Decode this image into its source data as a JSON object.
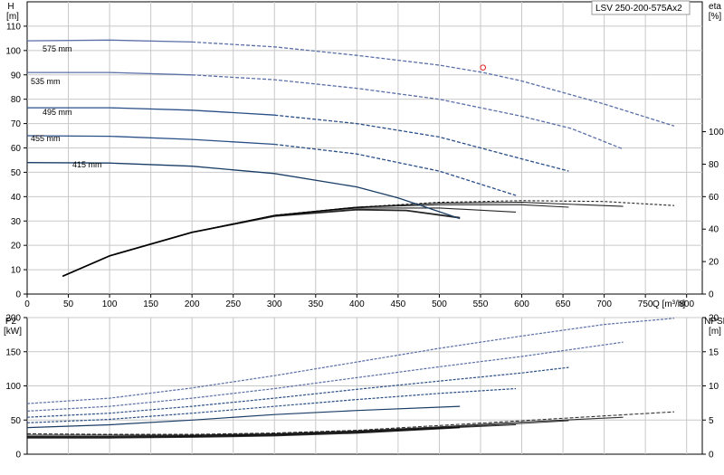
{
  "chart_data": [
    {
      "type": "line",
      "model_label": "LSV 250-200-575Ax2",
      "xlabel": "Q [m³/h]",
      "ylabel_left": [
        "H",
        "[m]"
      ],
      "ylabel_right": [
        "eta",
        "[%]"
      ],
      "xlim": [
        0,
        800
      ],
      "xticks": [
        0,
        50,
        100,
        150,
        200,
        250,
        300,
        350,
        400,
        450,
        500,
        550,
        600,
        650,
        700,
        750,
        800
      ],
      "ylim": [
        0,
        120
      ],
      "yticks": [
        0,
        10,
        20,
        30,
        40,
        50,
        60,
        70,
        80,
        90,
        100,
        110
      ],
      "y2lim": [
        0,
        180
      ],
      "y2ticks": [
        0,
        20,
        40,
        60,
        80,
        100
      ],
      "grid": true,
      "marker": {
        "x": 553,
        "y": 93
      },
      "head_series": [
        {
          "name": "575 mm",
          "points": [
            [
              0,
              104
            ],
            [
              100,
              104.3
            ],
            [
              200,
              103.5
            ],
            [
              300,
              101.5
            ],
            [
              400,
              98
            ],
            [
              500,
              94
            ],
            [
              553,
              91
            ],
            [
              600,
              87.5
            ],
            [
              700,
              78
            ],
            [
              785,
              69
            ]
          ]
        },
        {
          "name": "535 mm",
          "points": [
            [
              0,
              91
            ],
            [
              100,
              91
            ],
            [
              200,
              90
            ],
            [
              300,
              88
            ],
            [
              400,
              84.5
            ],
            [
              500,
              80
            ],
            [
              600,
              73
            ],
            [
              660,
              68
            ],
            [
              723,
              59.5
            ]
          ]
        },
        {
          "name": "495 mm",
          "points": [
            [
              0,
              76.5
            ],
            [
              100,
              76.5
            ],
            [
              200,
              75.5
            ],
            [
              300,
              73.5
            ],
            [
              400,
              70
            ],
            [
              500,
              64.5
            ],
            [
              600,
              55.5
            ],
            [
              657,
              50.5
            ]
          ]
        },
        {
          "name": "455 mm",
          "points": [
            [
              0,
              65
            ],
            [
              100,
              64.8
            ],
            [
              200,
              63.5
            ],
            [
              300,
              61.5
            ],
            [
              400,
              57.5
            ],
            [
              500,
              50.5
            ],
            [
              593,
              40.5
            ]
          ]
        },
        {
          "name": "415 mm",
          "points": [
            [
              0,
              54
            ],
            [
              100,
              53.8
            ],
            [
              200,
              52.5
            ],
            [
              300,
              49.5
            ],
            [
              400,
              44
            ],
            [
              450,
              39.5
            ],
            [
              525,
              31
            ]
          ]
        }
      ],
      "eta_series": [
        {
          "points": [
            [
              43,
              11
            ],
            [
              100,
              23.5
            ],
            [
              200,
              38
            ],
            [
              300,
              48.5
            ],
            [
              400,
              53.5
            ],
            [
              500,
              56.5
            ],
            [
              600,
              57.5
            ],
            [
              700,
              57
            ],
            [
              785,
              54.5
            ]
          ]
        },
        {
          "points": [
            [
              43,
              11
            ],
            [
              100,
              23.5
            ],
            [
              200,
              38
            ],
            [
              300,
              48.5
            ],
            [
              400,
              53.5
            ],
            [
              500,
              56
            ],
            [
              600,
              56.5
            ],
            [
              723,
              54
            ]
          ]
        },
        {
          "points": [
            [
              43,
              11
            ],
            [
              100,
              23.5
            ],
            [
              200,
              38
            ],
            [
              300,
              48.5
            ],
            [
              400,
              53.5
            ],
            [
              500,
              55
            ],
            [
              600,
              55
            ],
            [
              657,
              53.5
            ]
          ]
        },
        {
          "points": [
            [
              43,
              11
            ],
            [
              100,
              23.5
            ],
            [
              200,
              38
            ],
            [
              300,
              48.5
            ],
            [
              400,
              53
            ],
            [
              500,
              53
            ],
            [
              593,
              50.5
            ]
          ]
        },
        {
          "points": [
            [
              43,
              11
            ],
            [
              100,
              23.5
            ],
            [
              200,
              38
            ],
            [
              300,
              48
            ],
            [
              400,
              52
            ],
            [
              460,
              51.5
            ],
            [
              525,
              47
            ]
          ]
        }
      ]
    },
    {
      "type": "line",
      "xlim": [
        0,
        800
      ],
      "ylabel_left": [
        "P2",
        "[kW]"
      ],
      "ylabel_right": [
        "NPSH",
        "[m]"
      ],
      "ylim": [
        0,
        200
      ],
      "yticks": [
        0,
        50,
        100,
        150,
        200
      ],
      "y2lim": [
        0,
        20
      ],
      "y2ticks": [
        0,
        5,
        10,
        15,
        20
      ],
      "grid": true,
      "power_series": [
        {
          "points": [
            [
              0,
              74
            ],
            [
              100,
              82
            ],
            [
              200,
              97
            ],
            [
              300,
              115
            ],
            [
              400,
              135
            ],
            [
              500,
              155
            ],
            [
              600,
              173
            ],
            [
              700,
              190
            ],
            [
              785,
              199
            ]
          ]
        },
        {
          "points": [
            [
              0,
              63
            ],
            [
              100,
              70
            ],
            [
              200,
              82
            ],
            [
              300,
              96
            ],
            [
              400,
              112
            ],
            [
              500,
              128
            ],
            [
              600,
              143
            ],
            [
              723,
              164
            ]
          ]
        },
        {
          "points": [
            [
              0,
              54
            ],
            [
              100,
              60
            ],
            [
              200,
              70
            ],
            [
              300,
              82
            ],
            [
              400,
              95
            ],
            [
              500,
              107
            ],
            [
              600,
              119
            ],
            [
              657,
              127
            ]
          ]
        },
        {
          "points": [
            [
              0,
              46
            ],
            [
              100,
              51
            ],
            [
              200,
              60
            ],
            [
              300,
              70
            ],
            [
              400,
              80
            ],
            [
              500,
              89
            ],
            [
              593,
              96
            ]
          ]
        },
        {
          "points": [
            [
              0,
              39
            ],
            [
              100,
              43
            ],
            [
              200,
              50
            ],
            [
              300,
              58
            ],
            [
              400,
              64
            ],
            [
              525,
              70
            ]
          ]
        }
      ],
      "npsh_series": [
        {
          "points": [
            [
              0,
              3.0
            ],
            [
              100,
              2.9
            ],
            [
              200,
              2.9
            ],
            [
              300,
              3.1
            ],
            [
              400,
              3.5
            ],
            [
              500,
              4.2
            ],
            [
              600,
              4.9
            ],
            [
              700,
              5.6
            ],
            [
              785,
              6.2
            ]
          ]
        },
        {
          "points": [
            [
              0,
              2.8
            ],
            [
              100,
              2.8
            ],
            [
              200,
              2.8
            ],
            [
              300,
              3.0
            ],
            [
              400,
              3.4
            ],
            [
              500,
              4.0
            ],
            [
              600,
              4.7
            ],
            [
              723,
              5.4
            ]
          ]
        },
        {
          "points": [
            [
              0,
              2.6
            ],
            [
              100,
              2.6
            ],
            [
              200,
              2.7
            ],
            [
              300,
              2.9
            ],
            [
              400,
              3.3
            ],
            [
              500,
              3.9
            ],
            [
              600,
              4.5
            ],
            [
              657,
              4.9
            ]
          ]
        },
        {
          "points": [
            [
              0,
              2.5
            ],
            [
              100,
              2.5
            ],
            [
              200,
              2.6
            ],
            [
              300,
              2.8
            ],
            [
              400,
              3.2
            ],
            [
              500,
              3.8
            ],
            [
              593,
              4.3
            ]
          ]
        },
        {
          "points": [
            [
              0,
              2.4
            ],
            [
              100,
              2.4
            ],
            [
              200,
              2.5
            ],
            [
              300,
              2.7
            ],
            [
              400,
              3.1
            ],
            [
              525,
              3.9
            ]
          ]
        }
      ]
    }
  ],
  "colors": {
    "grid": "#c8c8c8",
    "axis": "#000000",
    "curve_dark": "#1a3d66",
    "curve_mid": "#2a4f88",
    "curve_light": "#5a6fa8",
    "eta": "#000000",
    "marker": "#e03030"
  }
}
